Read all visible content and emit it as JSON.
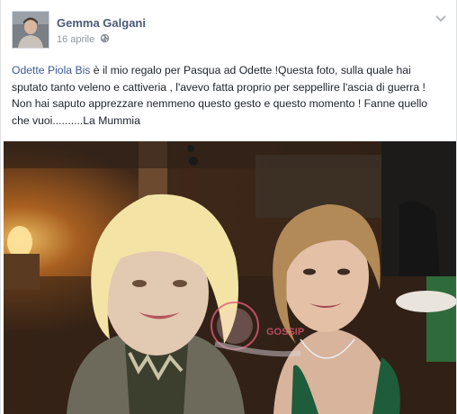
{
  "post": {
    "author": "Gemma Galgani",
    "date": "16 aprile",
    "audience_icon": "globe-icon",
    "menu_icon": "chevron-down-icon",
    "mention": "Odette Piola Bis",
    "text": " è il mio regalo per Pasqua ad Odette !Questa foto, sulla quale hai sputato tanto veleno e cattiveria , l'avevo fatta proprio per seppellire l'ascia di guerra ! Non hai saputo apprezzare nemmeno questo gesto e questo momento ! Fanne quello che vuoi..........La Mummia",
    "watermark": "GOSSIP"
  },
  "colors": {
    "author": "#4a5a78",
    "link": "#3b5998",
    "meta": "#90949c",
    "text": "#1d2129",
    "watermark": "#e05a7a"
  }
}
